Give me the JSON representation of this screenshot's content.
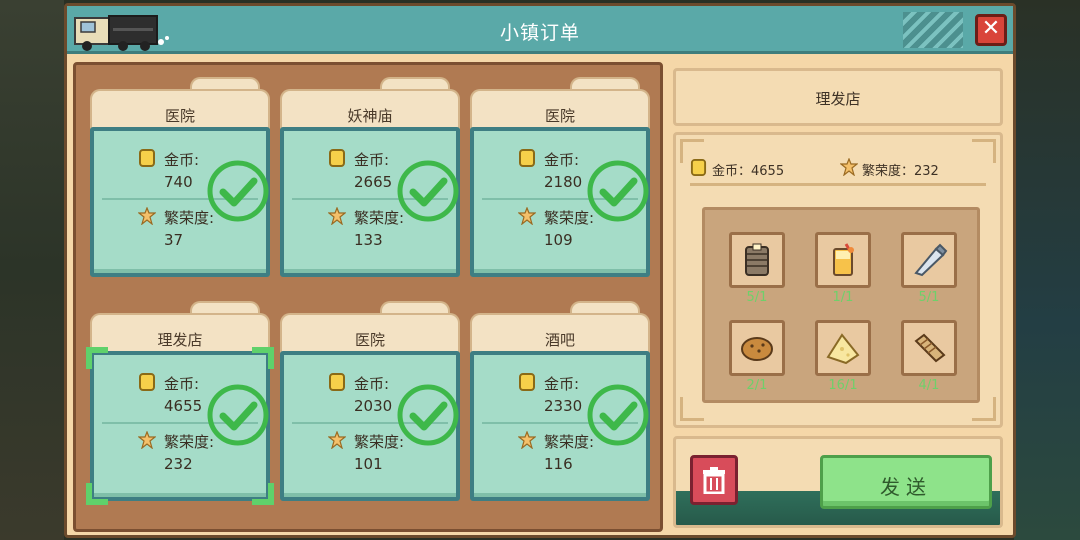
{
  "window": {
    "title": "小镇订单"
  },
  "colors": {
    "accent": "#5aa9a8",
    "check": "#3eb84a",
    "count_text": "#6fd06a",
    "send_button": "#8ee38a",
    "trash_button": "#d84c5a"
  },
  "orders": [
    {
      "name": "医院",
      "coin_label": "金币:",
      "coin": "740",
      "prosperity_label": "繁荣度:",
      "prosperity": "37",
      "completed": true
    },
    {
      "name": "妖神庙",
      "coin_label": "金币:",
      "coin": "2665",
      "prosperity_label": "繁荣度:",
      "prosperity": "133",
      "completed": true
    },
    {
      "name": "医院",
      "coin_label": "金币:",
      "coin": "2180",
      "prosperity_label": "繁荣度:",
      "prosperity": "109",
      "completed": true
    },
    {
      "name": "理发店",
      "coin_label": "金币:",
      "coin": "4655",
      "prosperity_label": "繁荣度:",
      "prosperity": "232",
      "completed": true,
      "selected": true
    },
    {
      "name": "医院",
      "coin_label": "金币:",
      "coin": "2030",
      "prosperity_label": "繁荣度:",
      "prosperity": "101",
      "completed": true
    },
    {
      "name": "酒吧",
      "coin_label": "金币:",
      "coin": "2330",
      "prosperity_label": "繁荣度:",
      "prosperity": "116",
      "completed": true
    }
  ],
  "detail": {
    "shop_name": "理发店",
    "coin_text": "金币：4655",
    "prosperity_text": "繁荣度：232",
    "items": [
      {
        "icon": "stack-icon",
        "count": "5/1"
      },
      {
        "icon": "drink-icon",
        "count": "1/1"
      },
      {
        "icon": "piping-bag-icon",
        "count": "5/1"
      },
      {
        "icon": "bread-icon",
        "count": "2/1"
      },
      {
        "icon": "cheese-icon",
        "count": "16/1"
      },
      {
        "icon": "roll-icon",
        "count": "4/1"
      }
    ]
  },
  "actions": {
    "send_label": "发送"
  }
}
